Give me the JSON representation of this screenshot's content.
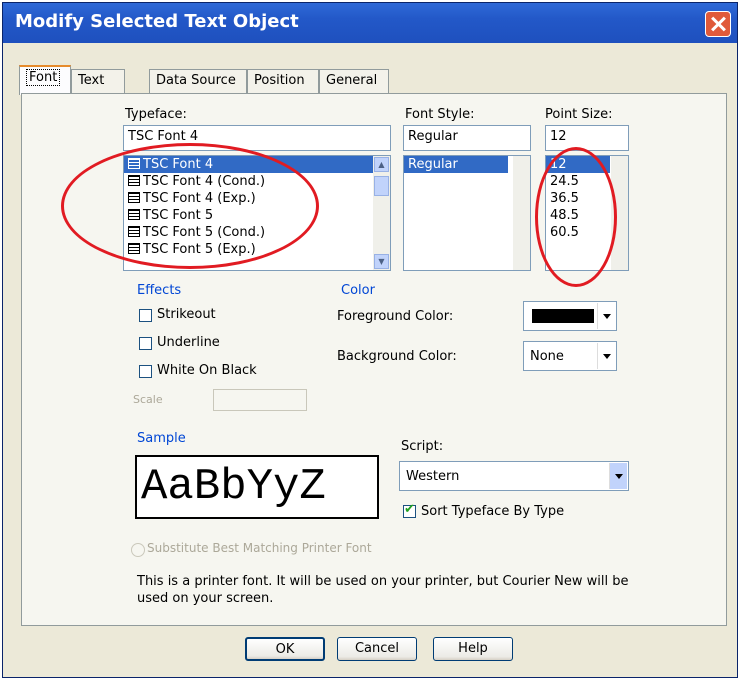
{
  "window": {
    "title": "Modify Selected Text Object"
  },
  "tabs": [
    "Font",
    "Text",
    "Data Source",
    "Position",
    "General"
  ],
  "typeface": {
    "label": "Typeface:",
    "value": "TSC Font 4",
    "items": [
      "TSC Font 4",
      "TSC Font 4 (Cond.)",
      "TSC Font 4 (Exp.)",
      "TSC Font 5",
      "TSC Font 5 (Cond.)",
      "TSC Font 5 (Exp.)"
    ],
    "selected_index": 0
  },
  "font_style": {
    "label": "Font Style:",
    "value": "Regular",
    "items": [
      "Regular"
    ]
  },
  "point_size": {
    "label": "Point Size:",
    "value": "12",
    "items": [
      "12",
      "24.5",
      "36.5",
      "48.5",
      "60.5"
    ]
  },
  "effects": {
    "title": "Effects",
    "strikeout": "Strikeout",
    "underline": "Underline",
    "white_on_black": "White On Black",
    "scale": "Scale"
  },
  "color": {
    "title": "Color",
    "foreground_label": "Foreground Color:",
    "foreground_value": "#000000",
    "background_label": "Background Color:",
    "background_value": "None"
  },
  "sample": {
    "title": "Sample",
    "text": "AaBbYyZ"
  },
  "script": {
    "label": "Script:",
    "value": "Western"
  },
  "sort_typeface": {
    "label": "Sort Typeface By Type",
    "checked": true
  },
  "substitute": {
    "label": "Substitute Best Matching Printer Font"
  },
  "info": "This is a printer font. It will be used on your printer, but Courier New will be used on your screen.",
  "buttons": {
    "ok": "OK",
    "cancel": "Cancel",
    "help": "Help"
  },
  "annotation_color": "#E11B22",
  "selection_color": "#316AC5"
}
